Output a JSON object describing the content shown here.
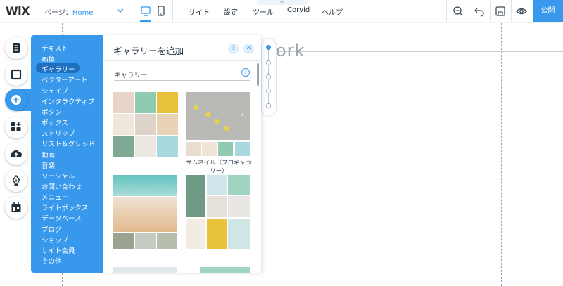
{
  "topbar": {
    "logo": "WiX",
    "page_prefix": "ページ：",
    "page_value": "Home",
    "menu": [
      "サイト",
      "設定",
      "ツール",
      "Corvid",
      "ヘルプ"
    ],
    "publish_label": "公開"
  },
  "canvas": {
    "bg_text": "ork"
  },
  "left_tools": {
    "icons": [
      "menus-pages-icon",
      "background-icon",
      "add-icon",
      "app-market-icon",
      "upload-icon",
      "blog-pen-icon",
      "bookings-icon"
    ]
  },
  "add_panel": {
    "categories": [
      "テキスト",
      "画像",
      "ギャラリー",
      "ベクターアート",
      "シェイプ",
      "インタラクティブ",
      "ボタン",
      "ボックス",
      "ストリップ",
      "リスト＆グリッド",
      "動画",
      "音楽",
      "ソーシャル",
      "お問い合わせ",
      "メニュー",
      "ライトボックス",
      "データベース",
      "ブログ",
      "ショップ",
      "サイト会員",
      "その他"
    ],
    "selected_index": 2,
    "title": "ギャラリーを追加",
    "help_label": "?",
    "close_label": "✕",
    "section_label": "ギャラリー",
    "info_label": "i",
    "caption": "サムネイル（プロギャラリー）"
  },
  "colors": {
    "accent": "#3899ec",
    "accent_dark": "#1e6fc0",
    "text": "#20303c"
  }
}
